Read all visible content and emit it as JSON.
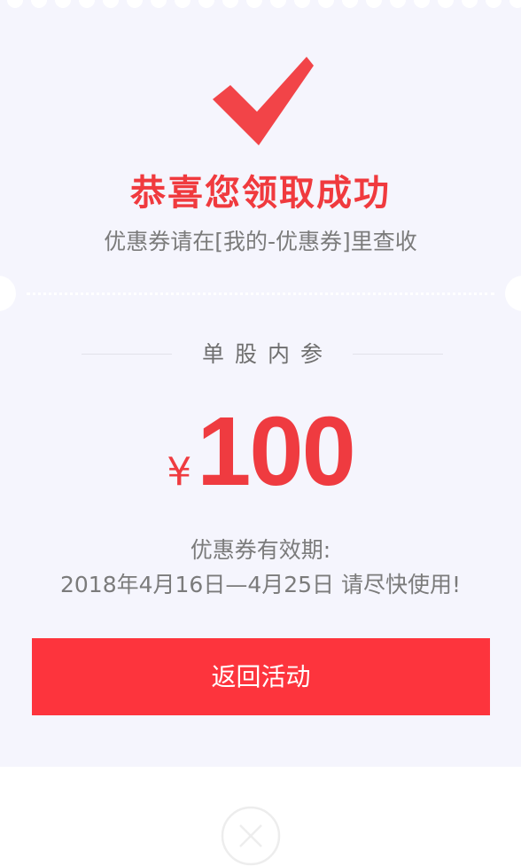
{
  "coupon": {
    "title": "恭喜您领取成功",
    "subtitle": "优惠券请在[我的-优惠券]里查收",
    "product_name": "单股内参",
    "currency_symbol": "¥",
    "amount": "100",
    "validity_label": "优惠券有效期:",
    "validity_range": "2018年4月16日—4月25日 请尽快使用!"
  },
  "actions": {
    "return_label": "返回活动"
  },
  "icons": {
    "check": "check-icon",
    "close": "close-icon"
  },
  "colors": {
    "accent": "#f03a3e",
    "button": "#fd343d",
    "card_background": "#f5f5fd",
    "muted_text": "#7b7b7b"
  }
}
